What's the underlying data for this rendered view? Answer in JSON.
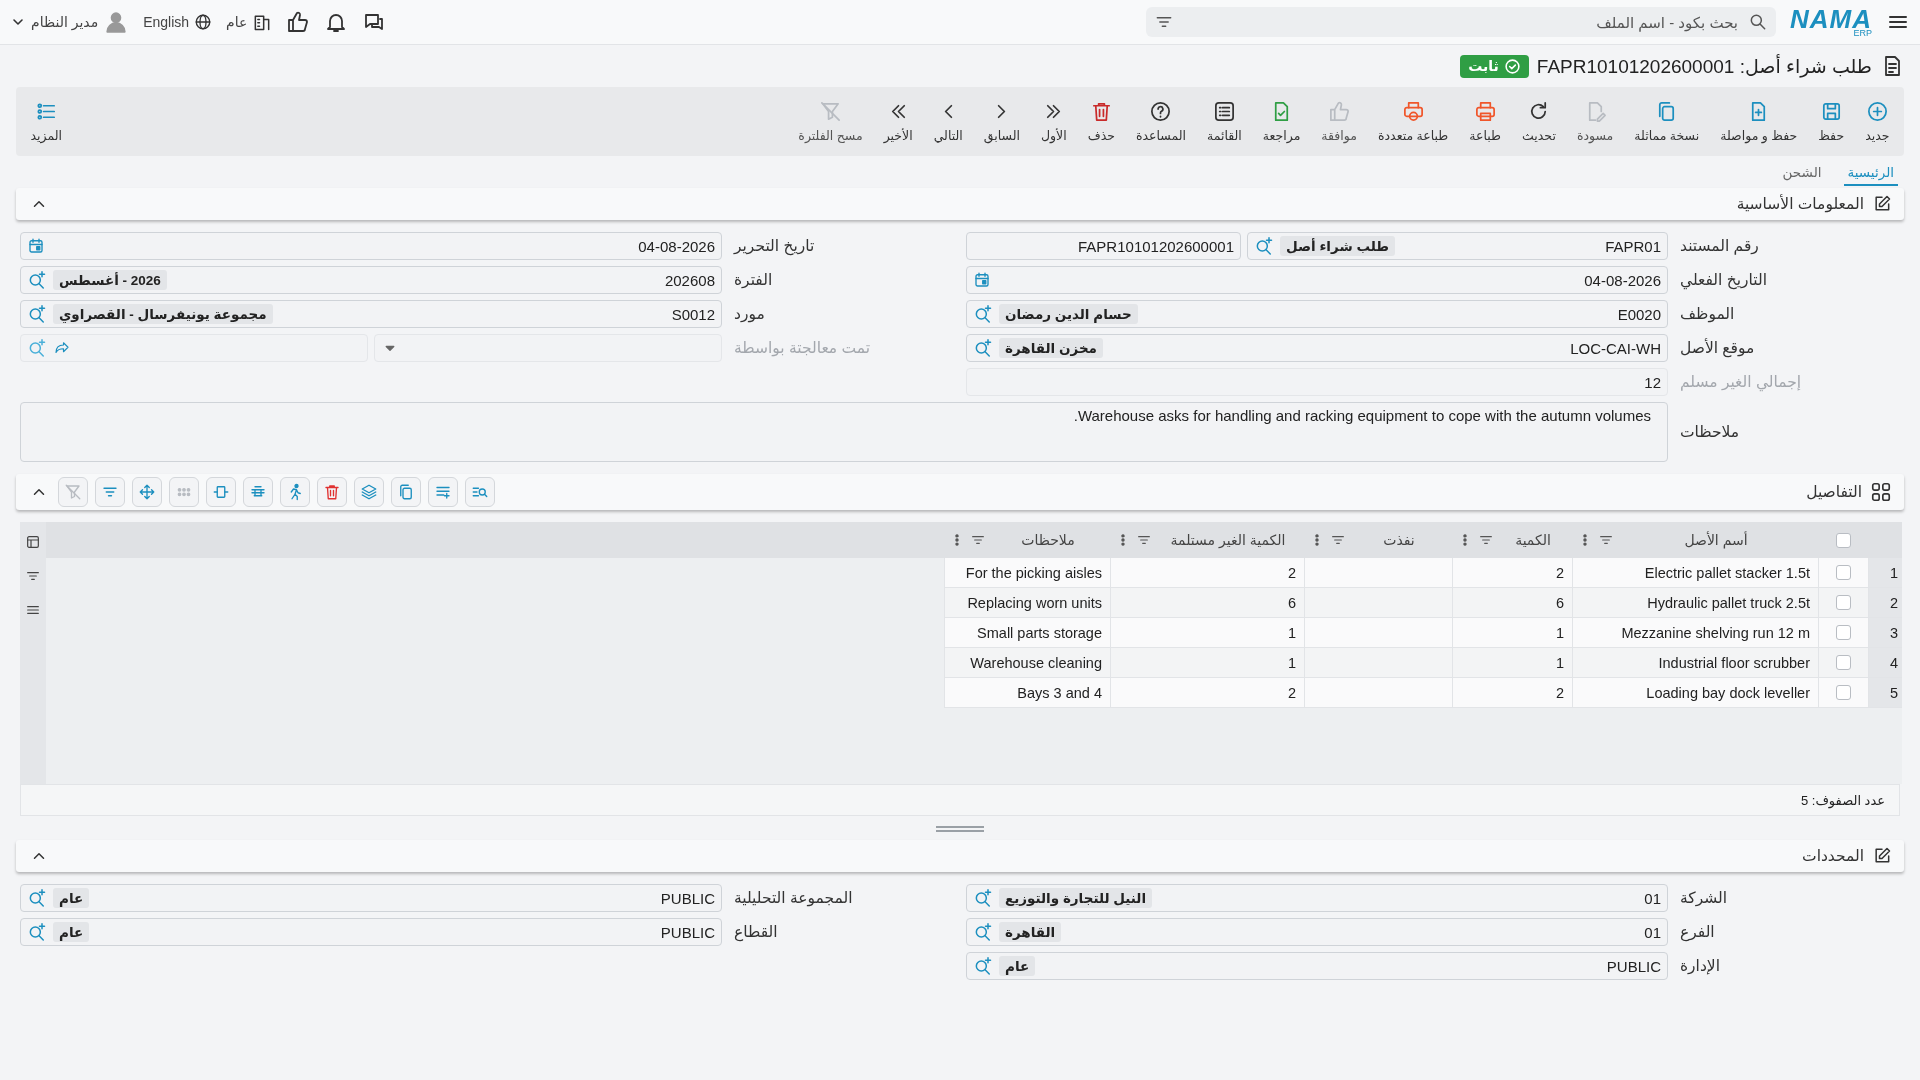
{
  "topbar": {
    "logo": {
      "name": "NAMA",
      "sub": "ERP"
    },
    "search": {
      "placeholder": "بحث بكود - اسم الملف"
    },
    "user": "مدير النظام",
    "language": "English",
    "scope": "عام"
  },
  "title": {
    "text": "طلب شراء أصل: FAPR10101202600001",
    "status": "ثابت"
  },
  "toolbar": [
    {
      "label": "جديد",
      "disabled": false
    },
    {
      "label": "حفظ",
      "disabled": false
    },
    {
      "label": "حفظ و مواصلة",
      "disabled": false
    },
    {
      "label": "نسخة مماثلة",
      "disabled": false
    },
    {
      "label": "مسودة",
      "disabled": true
    },
    {
      "label": "تحديث",
      "disabled": false
    },
    {
      "label": "طباعة",
      "disabled": false
    },
    {
      "label": "طباعة متعددة",
      "disabled": false
    },
    {
      "label": "موافقة",
      "disabled": true
    },
    {
      "label": "مراجعة",
      "disabled": false
    },
    {
      "label": "القائمة",
      "disabled": false
    },
    {
      "label": "المساعدة",
      "disabled": false
    },
    {
      "label": "حذف",
      "disabled": false
    },
    {
      "label": "الأول",
      "disabled": false
    },
    {
      "label": "السابق",
      "disabled": false
    },
    {
      "label": "التالي",
      "disabled": false
    },
    {
      "label": "الأخير",
      "disabled": false
    },
    {
      "label": "مسح الفلترة",
      "disabled": true
    }
  ],
  "more": "المزيد",
  "tabs": [
    {
      "label": "الرئيسية",
      "selected": true
    },
    {
      "label": "الشحن",
      "selected": false
    }
  ],
  "basic": {
    "title": "المعلومات الأساسية",
    "expanded": true,
    "right": [
      {
        "kind": "doc",
        "label": "رقم المستند",
        "value": "FAPR01",
        "chip": "طلب شراء أصل",
        "extra": "FAPR10101202600001",
        "disabled": false
      },
      {
        "kind": "date",
        "label": "التاريخ الفعلي",
        "value": "04-08-2026",
        "disabled": false
      },
      {
        "kind": "lookup",
        "label": "الموظف",
        "value": "E0020",
        "chip": "حسام الدين رمضان",
        "disabled": false
      },
      {
        "kind": "lookup",
        "label": "موقع الأصل",
        "value": "LOC-CAI-WH",
        "chip": "مخزن القاهرة",
        "disabled": false
      },
      {
        "kind": "readonly",
        "label": "إجمالي الغير مسلم",
        "value": "12",
        "disabled": true
      }
    ],
    "left": [
      {
        "kind": "date",
        "label": "تاريخ التحرير",
        "value": "04-08-2026",
        "disabled": false
      },
      {
        "kind": "lookup",
        "label": "الفترة",
        "value": "202608",
        "chip": "2026 - أغسطس",
        "disabled": false
      },
      {
        "kind": "lookup",
        "label": "مورد",
        "value": "S0012",
        "chip": "مجموعة يونيفرسال - القصراوي",
        "disabled": false
      },
      {
        "kind": "select",
        "label": "تمت معالجتة بواسطة",
        "disabled": true
      }
    ],
    "notes": {
      "label": "ملاحظات",
      "value": "Warehouse asks for handling and racking equipment to cope with the autumn volumes."
    }
  },
  "details": {
    "title": "التفاصيل",
    "expanded": true,
    "columns": [
      {
        "label": "أسم الأصل"
      },
      {
        "label": "الكمية"
      },
      {
        "label": "نفذت"
      },
      {
        "label": "الكمية الغير مستلمة"
      },
      {
        "label": "ملاحظات"
      }
    ],
    "header_checked": false,
    "rows": [
      {
        "num": "1",
        "checked": false,
        "asset": "Electric pallet stacker 1.5t",
        "quantity": "2",
        "unreceived": "2",
        "note": "For the picking aisles"
      },
      {
        "num": "2",
        "checked": false,
        "asset": "Hydraulic pallet truck 2.5t",
        "quantity": "6",
        "unreceived": "6",
        "note": "Replacing worn units"
      },
      {
        "num": "3",
        "checked": false,
        "asset": "Mezzanine shelving run 12 m",
        "quantity": "1",
        "unreceived": "1",
        "note": "Small parts storage"
      },
      {
        "num": "4",
        "checked": false,
        "asset": "Industrial floor scrubber",
        "quantity": "1",
        "unreceived": "1",
        "note": "Warehouse cleaning"
      },
      {
        "num": "5",
        "checked": false,
        "asset": "Loading bay dock leveller",
        "quantity": "2",
        "unreceived": "2",
        "note": "Bays 3 and 4"
      }
    ],
    "row_count": "عدد الصفوف: 5"
  },
  "dimensions": {
    "title": "المحددات",
    "expanded": true,
    "right": [
      {
        "kind": "lookup",
        "label": "الشركة",
        "value": "01",
        "chip": "النيل للتجارة والتوزيع",
        "disabled": false
      },
      {
        "kind": "lookup",
        "label": "الفرع",
        "value": "01",
        "chip": "القاهرة",
        "disabled": false
      },
      {
        "kind": "lookup",
        "label": "الإدارة",
        "value": "PUBLIC",
        "chip": "عام",
        "disabled": false
      }
    ],
    "left": [
      {
        "kind": "lookup",
        "label": "المجموعة التحليلية",
        "value": "PUBLIC",
        "chip": "عام",
        "disabled": false
      },
      {
        "kind": "lookup",
        "label": "القطاع",
        "value": "PUBLIC",
        "chip": "عام",
        "disabled": false
      }
    ]
  }
}
